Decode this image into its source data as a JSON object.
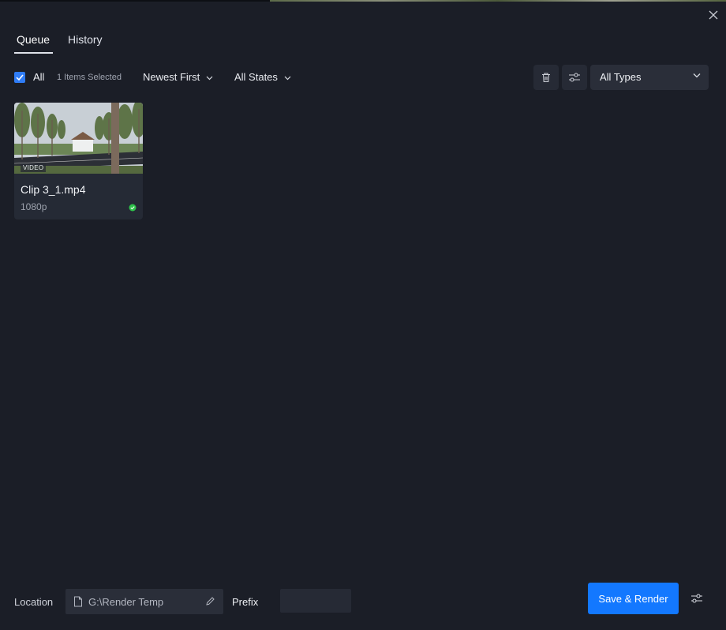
{
  "tabs": [
    {
      "label": "Queue",
      "active": true
    },
    {
      "label": "History",
      "active": false
    }
  ],
  "filters": {
    "select_all_label": "All",
    "select_all_checked": true,
    "selected_count": "1 Items Selected",
    "sort_label": "Newest First",
    "state_label": "All States",
    "type_label": "All Types"
  },
  "queue_items": [
    {
      "title": "Clip 3_1.mp4",
      "badge": "VIDEO",
      "resolution": "1080p",
      "status": "completed",
      "status_color": "#2ec24a"
    }
  ],
  "footer": {
    "location_label": "Location",
    "location_value": "G:\\Render Temp",
    "prefix_label": "Prefix",
    "prefix_value": "",
    "render_button": "Save & Render"
  },
  "colors": {
    "background": "#1b1e27",
    "accent": "#1378ff",
    "checkbox": "#2f7cf6"
  },
  "icons": {
    "close": "close-icon",
    "delete": "trash-icon",
    "filter_settings": "sliders-icon",
    "file": "file-icon",
    "edit": "pencil-icon",
    "render_settings": "sliders-icon"
  }
}
